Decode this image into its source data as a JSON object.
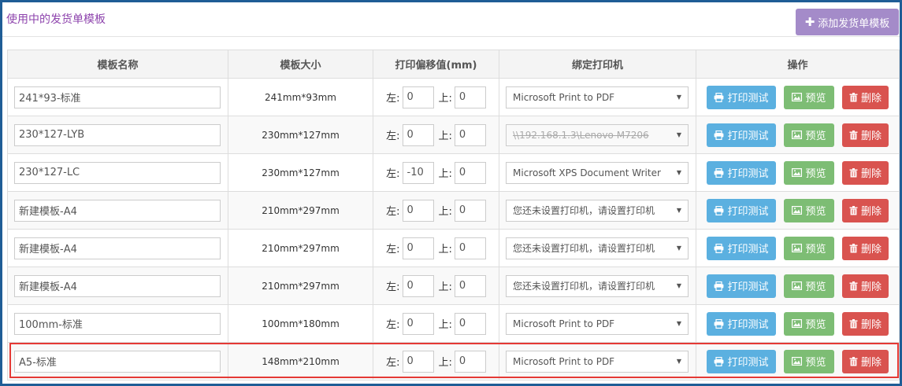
{
  "header": {
    "title": "使用中的发货单模板",
    "add_button": "添加发货单模板",
    "add_icon": "plus-icon"
  },
  "columns": [
    "模板名称",
    "模板大小",
    "打印偏移值(mm)",
    "绑定打印机",
    "操作"
  ],
  "offset_labels": {
    "left": "左:",
    "top": "上:"
  },
  "actions": {
    "test": "打印测试",
    "preview": "预览",
    "delete": "删除",
    "test_icon": "printer-icon",
    "preview_icon": "image-icon",
    "delete_icon": "trash-icon"
  },
  "rows": [
    {
      "name": "241*93-标准",
      "size": "241mm*93mm",
      "left": "0",
      "top": "0",
      "printer": "Microsoft Print to PDF",
      "printer_disabled": false
    },
    {
      "name": "230*127-LYB",
      "size": "230mm*127mm",
      "left": "0",
      "top": "0",
      "printer": "\\\\192.168.1.3\\Lenovo M7206",
      "printer_disabled": true
    },
    {
      "name": "230*127-LC",
      "size": "230mm*127mm",
      "left": "-10",
      "top": "0",
      "printer": "Microsoft XPS Document Writer",
      "printer_disabled": false
    },
    {
      "name": "新建模板-A4",
      "size": "210mm*297mm",
      "left": "0",
      "top": "0",
      "printer": "您还未设置打印机，请设置打印机",
      "printer_disabled": false
    },
    {
      "name": "新建模板-A4",
      "size": "210mm*297mm",
      "left": "0",
      "top": "0",
      "printer": "您还未设置打印机，请设置打印机",
      "printer_disabled": false
    },
    {
      "name": "新建模板-A4",
      "size": "210mm*297mm",
      "left": "0",
      "top": "0",
      "printer": "您还未设置打印机，请设置打印机",
      "printer_disabled": false
    },
    {
      "name": "100mm-标准",
      "size": "100mm*180mm",
      "left": "0",
      "top": "0",
      "printer": "Microsoft Print to PDF",
      "printer_disabled": false
    },
    {
      "name": "A5-标准",
      "size": "148mm*210mm",
      "left": "0",
      "top": "0",
      "printer": "Microsoft Print to PDF",
      "printer_disabled": false,
      "highlighted": true
    }
  ]
}
